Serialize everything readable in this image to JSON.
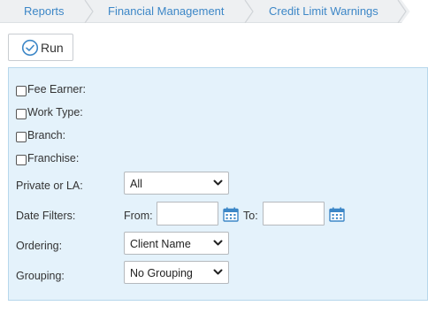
{
  "breadcrumb": {
    "items": [
      {
        "label": "Reports"
      },
      {
        "label": "Financial Management"
      },
      {
        "label": "Credit Limit Warnings"
      }
    ]
  },
  "toolbar": {
    "run_label": "Run",
    "run_icon": "check-circle-icon"
  },
  "filters": {
    "checkboxes": [
      {
        "label": "Fee Earner:",
        "checked": false
      },
      {
        "label": "Work Type:",
        "checked": false
      },
      {
        "label": "Branch:",
        "checked": false
      },
      {
        "label": "Franchise:",
        "checked": false
      }
    ],
    "private_or_la": {
      "label": "Private or LA:",
      "value": "All"
    },
    "date_filters": {
      "label": "Date Filters:",
      "from_label": "From:",
      "to_label": "To:",
      "from_value": "",
      "to_value": ""
    },
    "ordering": {
      "label": "Ordering:",
      "value": "Client Name"
    },
    "grouping": {
      "label": "Grouping:",
      "value": "No Grouping"
    }
  },
  "colors": {
    "accent": "#3d87c7",
    "panel_bg": "#e4f2fb",
    "panel_border": "#b7d7ec"
  }
}
